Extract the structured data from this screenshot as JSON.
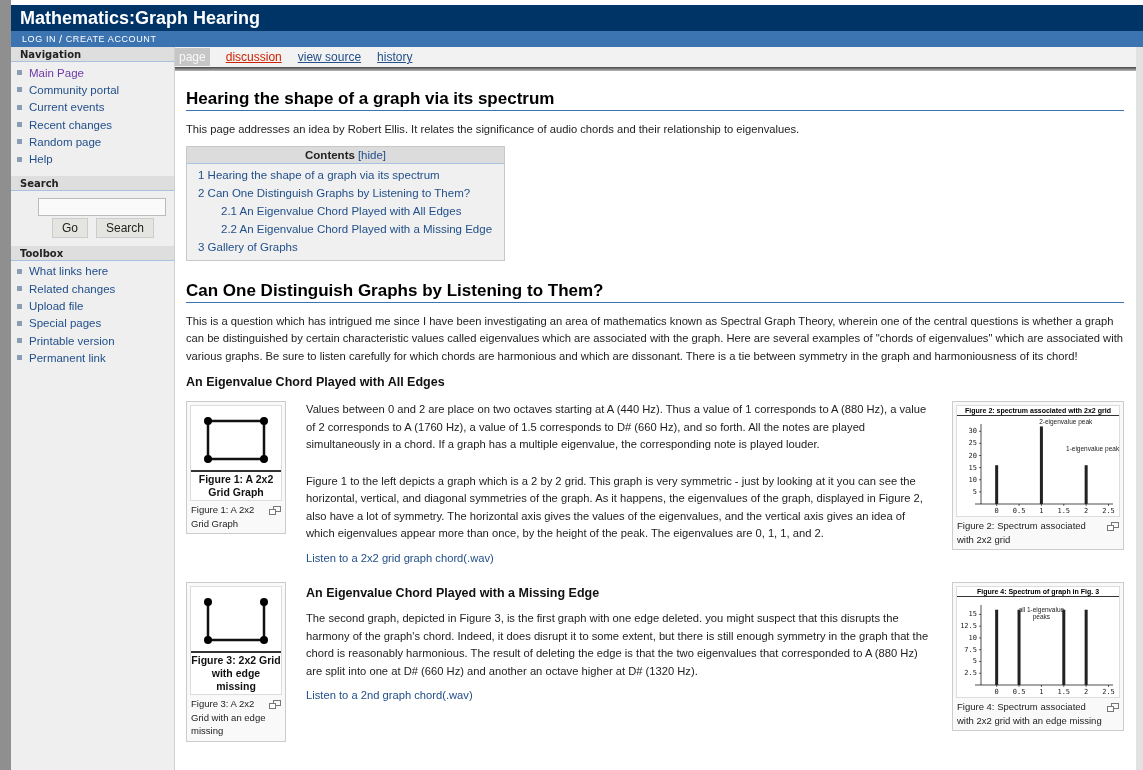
{
  "header": {
    "title": "Mathematics:Graph Hearing",
    "account_links": [
      "LOG IN",
      "CREATE ACCOUNT"
    ],
    "separator": "/"
  },
  "sidebar": {
    "navigation": {
      "heading": "Navigation",
      "items": [
        {
          "label": "Main Page",
          "visited": true
        },
        {
          "label": "Community portal",
          "visited": false
        },
        {
          "label": "Current events",
          "visited": false
        },
        {
          "label": "Recent changes",
          "visited": false
        },
        {
          "label": "Random page",
          "visited": false
        },
        {
          "label": "Help",
          "visited": false
        }
      ]
    },
    "search": {
      "heading": "Search",
      "buttons": [
        "Go",
        "Search"
      ]
    },
    "toolbox": {
      "heading": "Toolbox",
      "items": [
        {
          "label": "What links here",
          "visited": false
        },
        {
          "label": "Related changes",
          "visited": false
        },
        {
          "label": "Upload file",
          "visited": false
        },
        {
          "label": "Special pages",
          "visited": false
        },
        {
          "label": "Printable version",
          "visited": false
        },
        {
          "label": "Permanent link",
          "visited": false
        }
      ]
    }
  },
  "tabs": [
    {
      "label": "page",
      "selected": true,
      "redlink": false
    },
    {
      "label": "discussion",
      "selected": false,
      "redlink": true
    },
    {
      "label": "view source",
      "selected": false,
      "redlink": false
    },
    {
      "label": "history",
      "selected": false,
      "redlink": false
    }
  ],
  "article": {
    "title": "Hearing the shape of a graph via its spectrum",
    "intro": "This page addresses an idea by Robert Ellis. It relates the significance of audio chords and their relationship to eigenvalues.",
    "toc": {
      "title": "Contents",
      "toggle": "[hide]",
      "items": [
        {
          "label": "1 Hearing the shape of a graph via its spectrum"
        },
        {
          "label": "2 Can One Distinguish Graphs by Listening to Them?",
          "children": [
            {
              "label": "2.1 An Eigenvalue Chord Played with All Edges"
            },
            {
              "label": "2.2 An Eigenvalue Chord Played with a Missing Edge"
            }
          ]
        },
        {
          "label": "3 Gallery of Graphs"
        }
      ]
    },
    "section": {
      "heading": "Can One Distinguish Graphs by Listening to Them?",
      "paragraph": "This is a question which has intrigued me since I have been investigating an area of mathematics known as Spectral Graph Theory, wherein one of the central questions is whether a graph can be distinguished by certain characteristic values called eigenvalues which are associated with the graph. Here are several examples of \"chords of eigenvalues\" which are associated with various graphs. Be sure to listen carefully for which chords are harmonious and which are dissonant. There is a tie between symmetry in the graph and harmoniousness of its chord!",
      "subheading": "An Eigenvalue Chord Played with All Edges",
      "blocks": [
        {
          "figure_left": {
            "top_edge": true,
            "image_title": "Figure 1: A 2x2 Grid Graph",
            "caption": "Figure 1: A 2x2 Grid Graph"
          },
          "content": [
            {
              "kind": "paragraph",
              "text": "Values between 0 and 2 are place on two octaves starting at A (440 Hz). Thus a value of 1 corresponds to A (880 Hz), a value of 2 corresponds to A (1760 Hz), a value of 1.5 corresponds to D# (660 Hz), and so forth. All the notes are played simultaneously in a chord. If a graph has a multiple eigenvalue, the corresponding note is played louder."
            },
            {
              "kind": "spacer"
            },
            {
              "kind": "paragraph",
              "text": "Figure 1 to the left depicts a graph which is a 2 by 2 grid. This graph is very symmetric - just by looking at it you can see the horizontal, vertical, and diagonal symmetries of the graph. As it happens, the eigenvalues of the graph, displayed in Figure 2, also have a lot of symmetry. The horizontal axis gives the values of the eigenvalues, and the vertical axis gives an idea of which eigenvalues appear more than once, by the height of the peak. The eigenvalues are 0, 1, 1, and 2."
            },
            {
              "kind": "link",
              "text": "Listen to a 2x2 grid graph chord(.wav)"
            }
          ],
          "figure_right": {
            "caption": "Figure 2: Spectrum associated with 2x2 grid",
            "chart_data": {
              "type": "bar",
              "title": "Figure 2: spectrum associated with 2x2 grid",
              "x": [
                0,
                1,
                2
              ],
              "series": [
                {
                  "color": "#222222",
                  "values": [
                    16,
                    32,
                    16
                  ]
                }
              ],
              "xlim": [
                -0.35,
                2.6
              ],
              "ylim": [
                0,
                33
              ],
              "xticks": [
                0,
                0.5,
                1,
                1.5,
                2,
                2.5
              ],
              "yticks": [
                5,
                10,
                15,
                20,
                25,
                30
              ],
              "annotations": [
                "2-eigenvalue peak",
                "1-eigenvalue peak"
              ]
            }
          }
        },
        {
          "figure_left": {
            "top_edge": false,
            "image_title": "Figure 3: 2x2 Grid with edge missing",
            "caption": "Figure 3: A 2x2 Grid with an edge missing"
          },
          "content": [
            {
              "kind": "subheading",
              "text": "An Eigenvalue Chord Played with a Missing Edge"
            },
            {
              "kind": "paragraph",
              "text": "The second graph, depicted in Figure 3, is the first graph with one edge deleted. you might suspect that this disrupts the harmony of the graph's chord. Indeed, it does disrupt it to some extent, but there is still enough symmetry in the graph that the chord is reasonably harmonious. The result of deleting the edge is that the two eigenvalues that corresponded to A (880 Hz) are split into one at D# (660 Hz) and another an octave higher at D# (1320 Hz)."
            },
            {
              "kind": "link",
              "text": "Listen to a 2nd graph chord(.wav)"
            }
          ],
          "figure_right": {
            "caption": "Figure 4: Spectrum associated with 2x2 grid with an edge missing",
            "chart_data": {
              "type": "bar",
              "title": "Figure 4: Spectrum of graph in Fig. 3",
              "x": [
                0,
                0.5,
                1.5,
                2
              ],
              "series": [
                {
                  "color": "#222222",
                  "values": [
                    16,
                    16,
                    16,
                    16
                  ]
                }
              ],
              "xlim": [
                -0.35,
                2.6
              ],
              "ylim": [
                0,
                17
              ],
              "xticks": [
                0,
                0.5,
                1,
                1.5,
                2,
                2.5
              ],
              "yticks": [
                2.5,
                5,
                7.5,
                10,
                12.5,
                15
              ],
              "annotations": [
                "all 1-eigenvalue",
                "peaks"
              ]
            }
          }
        }
      ]
    }
  }
}
